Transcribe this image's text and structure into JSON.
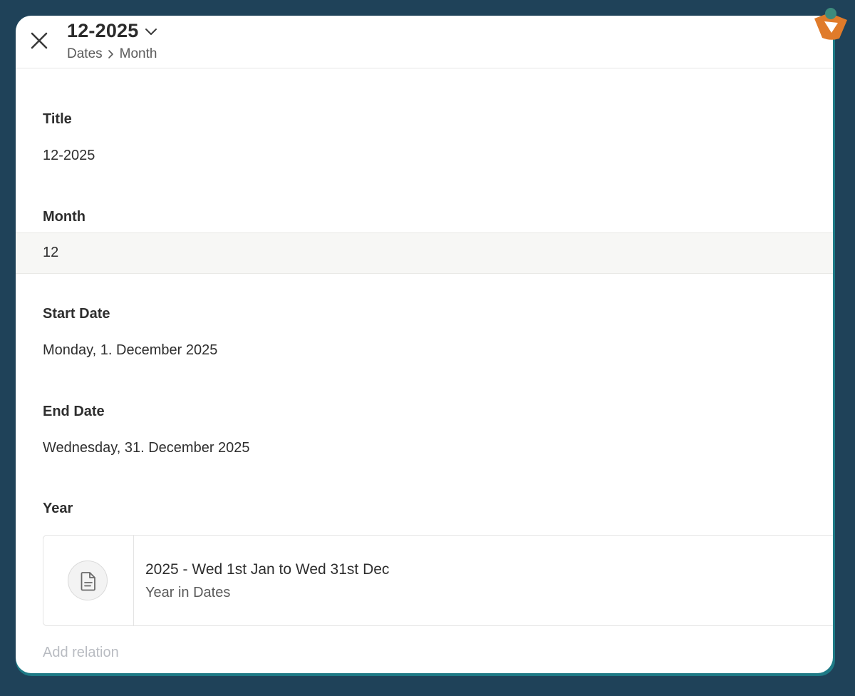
{
  "header": {
    "title": "12-2025",
    "breadcrumb": [
      "Dates",
      "Month"
    ]
  },
  "fields": {
    "title": {
      "label": "Title",
      "value": "12-2025"
    },
    "month": {
      "label": "Month",
      "value": "12"
    },
    "start_date": {
      "label": "Start Date",
      "value": "Monday, 1. December 2025"
    },
    "end_date": {
      "label": "End Date",
      "value": "Wednesday, 31. December 2025"
    },
    "year": {
      "label": "Year",
      "relation": {
        "title": "2025 - Wed 1st Jan to Wed 31st Dec",
        "subtitle": "Year in Dates",
        "icon": "document-icon"
      },
      "add_label": "Add relation"
    }
  },
  "icons": {
    "close": "close-icon",
    "title_dropdown": "chevron-down-icon",
    "breadcrumb_separator": "chevron-right-icon",
    "app_logo": "app-logo-icon"
  },
  "colors": {
    "background": "#1f4259",
    "card_border": "#1e7a86",
    "card": "#ffffff",
    "highlight_row": "#f7f7f5",
    "text": "#2e2e2e",
    "muted": "#b9bcc2",
    "logo_orange": "#e07b2a",
    "logo_teal": "#3d8b7d"
  }
}
